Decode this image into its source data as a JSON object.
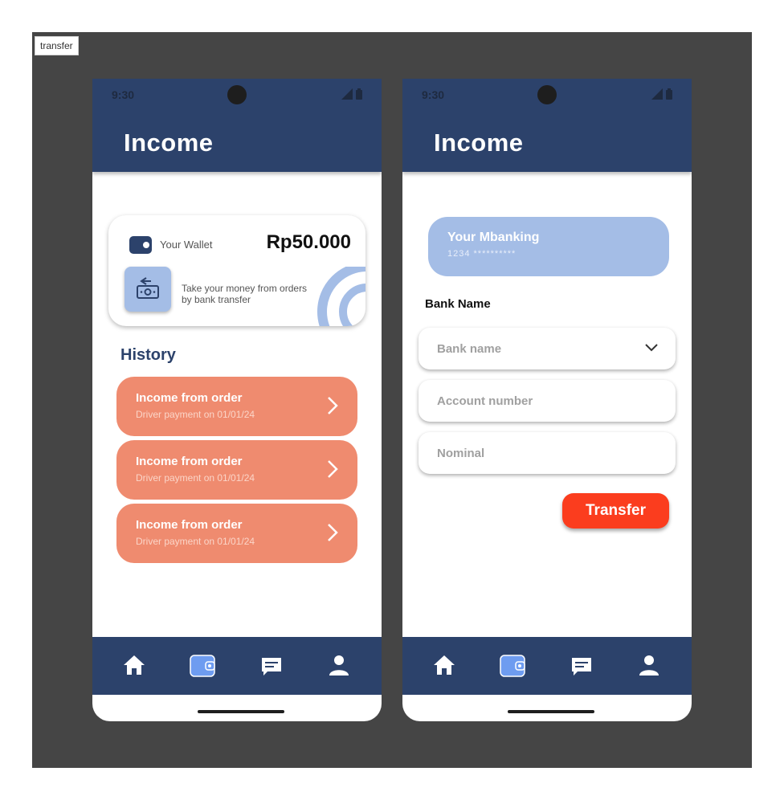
{
  "frame": {
    "label": "transfer"
  },
  "status": {
    "time": "9:30"
  },
  "screen1": {
    "title": "Income",
    "wallet": {
      "label": "Your Wallet",
      "amount": "Rp50.000",
      "description": "Take your money from orders by bank transfer"
    },
    "history_title": "History",
    "history": [
      {
        "title": "Income from order",
        "subtitle": "Driver payment on 01/01/24"
      },
      {
        "title": "Income from order",
        "subtitle": "Driver payment on 01/01/24"
      },
      {
        "title": "Income from order",
        "subtitle": "Driver payment on 01/01/24"
      }
    ]
  },
  "screen2": {
    "title": "Income",
    "mbanking": {
      "title": "Your Mbanking",
      "number": "1234 **********"
    },
    "bank_name_label": "Bank Name",
    "fields": {
      "bank_name_placeholder": "Bank name",
      "account_placeholder": "Account number",
      "nominal_placeholder": "Nominal"
    },
    "submit_label": "Transfer"
  },
  "nav": {
    "items": [
      {
        "icon": "home-icon",
        "active": false
      },
      {
        "icon": "wallet-icon",
        "active": true
      },
      {
        "icon": "chat-icon",
        "active": false
      },
      {
        "icon": "profile-icon",
        "active": false
      }
    ]
  },
  "colors": {
    "primary": "#2c426b",
    "accent_light": "#a4bde6",
    "history_item": "#ef8b6f",
    "transfer_button": "#fb3d1e",
    "frame_bg": "#454545"
  }
}
